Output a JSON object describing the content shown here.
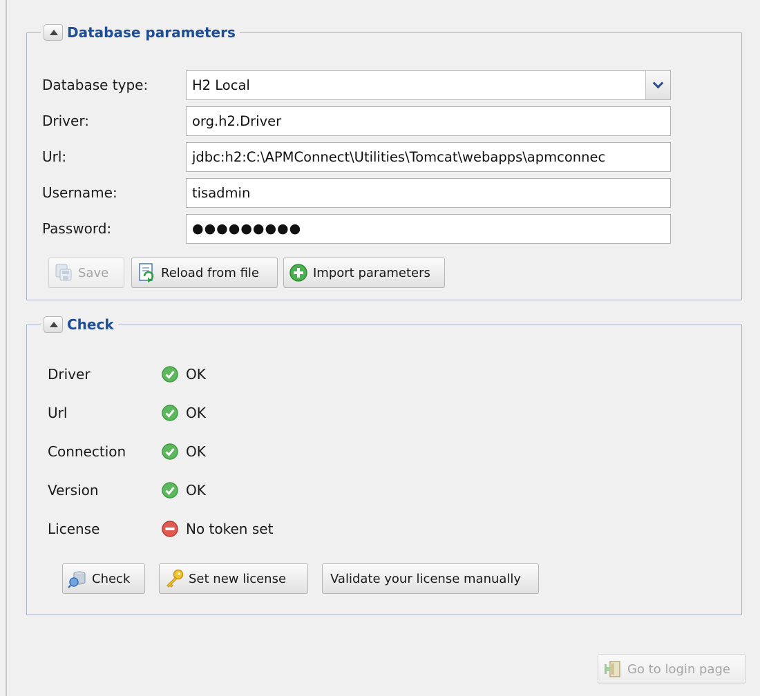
{
  "database_panel": {
    "legend": "Database parameters",
    "fields": [
      {
        "label": "Database type:",
        "value": "H2 Local"
      },
      {
        "label": "Driver:",
        "value": "org.h2.Driver"
      },
      {
        "label": "Url:",
        "value": "jdbc:h2:C:\\APMConnect\\Utilities\\Tomcat\\webapps\\apmconnec"
      },
      {
        "label": "Username:",
        "value": "tisadmin"
      },
      {
        "label": "Password:",
        "value": "●●●●●●●●●"
      }
    ],
    "buttons": {
      "save": "Save",
      "reload": "Reload from file",
      "import": "Import parameters"
    }
  },
  "check_panel": {
    "legend": "Check",
    "items": [
      {
        "label": "Driver",
        "status": "OK",
        "state": "ok"
      },
      {
        "label": "Url",
        "status": "OK",
        "state": "ok"
      },
      {
        "label": "Connection",
        "status": "OK",
        "state": "ok"
      },
      {
        "label": "Version",
        "status": "OK",
        "state": "ok"
      },
      {
        "label": "License",
        "status": "No token set",
        "state": "error"
      }
    ],
    "buttons": {
      "check": "Check",
      "set_license": "Set new license",
      "validate": "Validate your license manually"
    }
  },
  "footer": {
    "login_button": "Go to login page"
  },
  "colors": {
    "legend_text": "#1e4e96",
    "ok_icon": "#5cb85c",
    "error_icon": "#d9534f"
  }
}
